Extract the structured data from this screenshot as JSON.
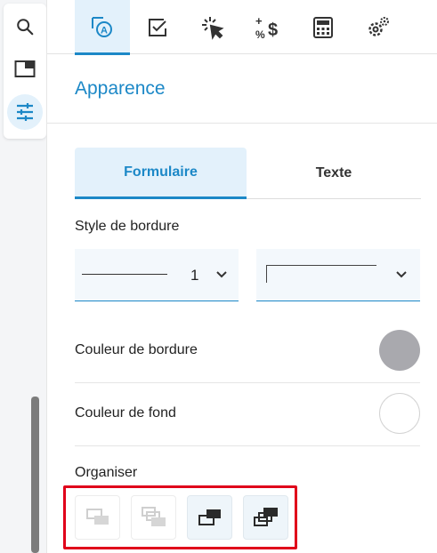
{
  "rail": {
    "items": [
      {
        "icon": "search-icon"
      },
      {
        "icon": "panel-icon"
      },
      {
        "icon": "sliders-icon",
        "active": true
      }
    ]
  },
  "tabs": [
    {
      "icon": "appearance-icon",
      "active": true
    },
    {
      "icon": "checkbox-icon"
    },
    {
      "icon": "cursor-click-icon"
    },
    {
      "icon": "calculation-icon"
    },
    {
      "icon": "calculator-icon"
    },
    {
      "icon": "settings-icon"
    }
  ],
  "section_title": "Apparence",
  "segments": {
    "form": "Formulaire",
    "text": "Texte"
  },
  "border_style": {
    "label": "Style de bordure",
    "width_value": "1"
  },
  "border_color": {
    "label": "Couleur de bordure",
    "value": "#a9a9ae"
  },
  "fill_color": {
    "label": "Couleur de fond",
    "value": "#ffffff"
  },
  "organize": {
    "label": "Organiser"
  },
  "colors": {
    "accent": "#1c88c7",
    "highlight": "#e0001a"
  }
}
